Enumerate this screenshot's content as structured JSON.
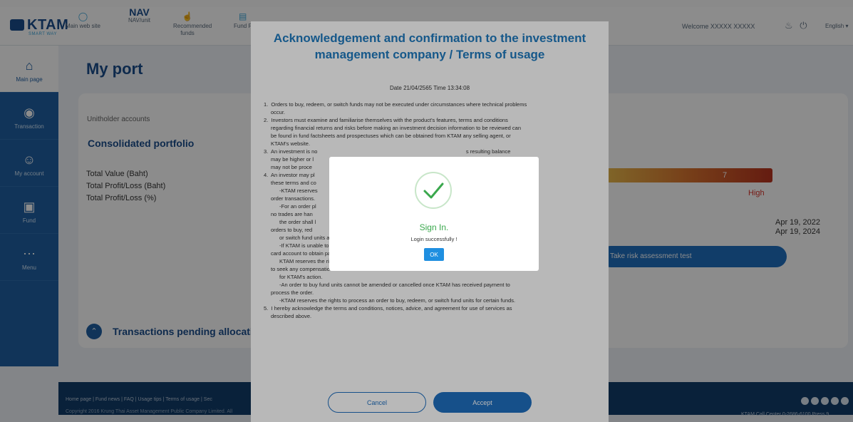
{
  "header": {
    "logo_text": "KTAM",
    "logo_sub": "SMART WAY",
    "nav": [
      {
        "label": "Main web site",
        "icon": "globe-icon"
      },
      {
        "label": "NAV/unit",
        "top": "NAV",
        "icon": "nav-text-icon"
      },
      {
        "label": "Recommended funds",
        "icon": "thumbs-up-icon"
      },
      {
        "label": "Fund F",
        "icon": "chart-icon"
      },
      {
        "label": "",
        "icon": "calendar-icon"
      }
    ],
    "welcome": "Welcome XXXXX XXXXX",
    "language": "English ▾"
  },
  "sidebar": {
    "items": [
      {
        "label": "Main page",
        "icon": "home-icon"
      },
      {
        "label": "Transaction",
        "icon": "money-bag-icon"
      },
      {
        "label": "My account",
        "icon": "user-icon"
      },
      {
        "label": "Fund",
        "icon": "fund-icon"
      },
      {
        "label": "Menu",
        "icon": "dots-icon"
      }
    ]
  },
  "main": {
    "title": "My port",
    "unitholder_label": "Unitholder accounts",
    "consolidated": "Consolidated portfolio",
    "total_value": "Total Value (Baht)",
    "total_pl_baht": "Total Profit/Loss (Baht)",
    "total_pl_pct": "Total Profit/Loss (%)",
    "risk_level": "7",
    "risk_label": "High",
    "date_1": "Apr 19, 2022",
    "date_2": "Apr 19, 2024",
    "risk_button": "Take risk assessment test",
    "pending": "Transactions pending allocation"
  },
  "footer": {
    "links": "Home page | Fund news | FAQ | Usage tips | Terms of usage | Sec",
    "copyright": "Copyright 2016 Krung Thai Asset Management Public Company Limited. All",
    "call_center": "KTAM Call Center 0-2686-6100 Press 9"
  },
  "terms": {
    "title": "Acknowledgement and confirmation to the investment management company / Terms of usage",
    "date": "Date 21/04/2565 Time 13:34:08",
    "lines": [
      {
        "t": "1.  Orders to buy, redeem, or switch funds may not be executed under circumstances where technical problems",
        "c": ""
      },
      {
        "t": "occur.",
        "c": "ind"
      },
      {
        "t": "2.  Investors must examine and familiarise themselves with the product's features, terms and conditions",
        "c": ""
      },
      {
        "t": "regarding financial returns and risks before making an investment decision information to be reviewed can",
        "c": "ind"
      },
      {
        "t": "be found in fund factsheets and prospectuses which can be obtained from KTAM any selling agent, or",
        "c": "ind"
      },
      {
        "t": "KTAM's website.",
        "c": "ind"
      },
      {
        "t": "3.  An investment is no                                                                                                    s resulting balance",
        "c": ""
      },
      {
        "t": "may be higher or l                                                                                                     ption payment",
        "c": "ind"
      },
      {
        "t": "may not be proce                                                                                                      cted as instructed.",
        "c": "ind"
      },
      {
        "t": "4.  An investor may pl                                                                                                   s a day , under",
        "c": ""
      },
      {
        "t": "these terms and co",
        "c": "ind"
      },
      {
        "t": "-KTAM reserves                                                                                                     s when processing",
        "c": "ind2"
      },
      {
        "t": "order transactions.",
        "c": "ind"
      },
      {
        "t": "-For an order pl                                                                                                     d holidays where",
        "c": "ind2"
      },
      {
        "t": "no trades are han",
        "c": "ind"
      },
      {
        "t": "the order shall l                                                                                                     ys for processing",
        "c": "ind2"
      },
      {
        "t": "orders to buy, red",
        "c": "ind"
      },
      {
        "t": "or switch fund units are according to schedules described in each fund's prospectus.",
        "c": "ind2"
      },
      {
        "t": "-If KTAM is unable to obtain payment by deducting the unitholder's designated bank account or credit",
        "c": "ind2"
      },
      {
        "t": "card account to obtain payment for a buy order,",
        "c": "ind"
      },
      {
        "t": "KTAM reserves the rights to void that particular buy order. Simultaneously, you agree to waive all rights",
        "c": "ind2"
      },
      {
        "t": "to seek any compensation",
        "c": "ind"
      },
      {
        "t": "for KTAM's action.",
        "c": "ind2"
      },
      {
        "t": "-An order to buy fund units cannot be amended or cancelled once KTAM has received payment to",
        "c": "ind2"
      },
      {
        "t": "process the order.",
        "c": "ind"
      },
      {
        "t": "-KTAM reserves the rights to process an order to buy, redeem, or switch fund units for certain funds.",
        "c": "ind2"
      },
      {
        "t": "5.  I hereby acknowledge the terms and conditions, notices, advice, and agreement for use of services as",
        "c": ""
      },
      {
        "t": "described above.",
        "c": "ind"
      }
    ],
    "cancel": "Cancel",
    "accept": "Accept"
  },
  "signin_dialog": {
    "title": "Sign In.",
    "message": "Login successfully !",
    "ok": "OK",
    "accent": "#3aa84d"
  }
}
